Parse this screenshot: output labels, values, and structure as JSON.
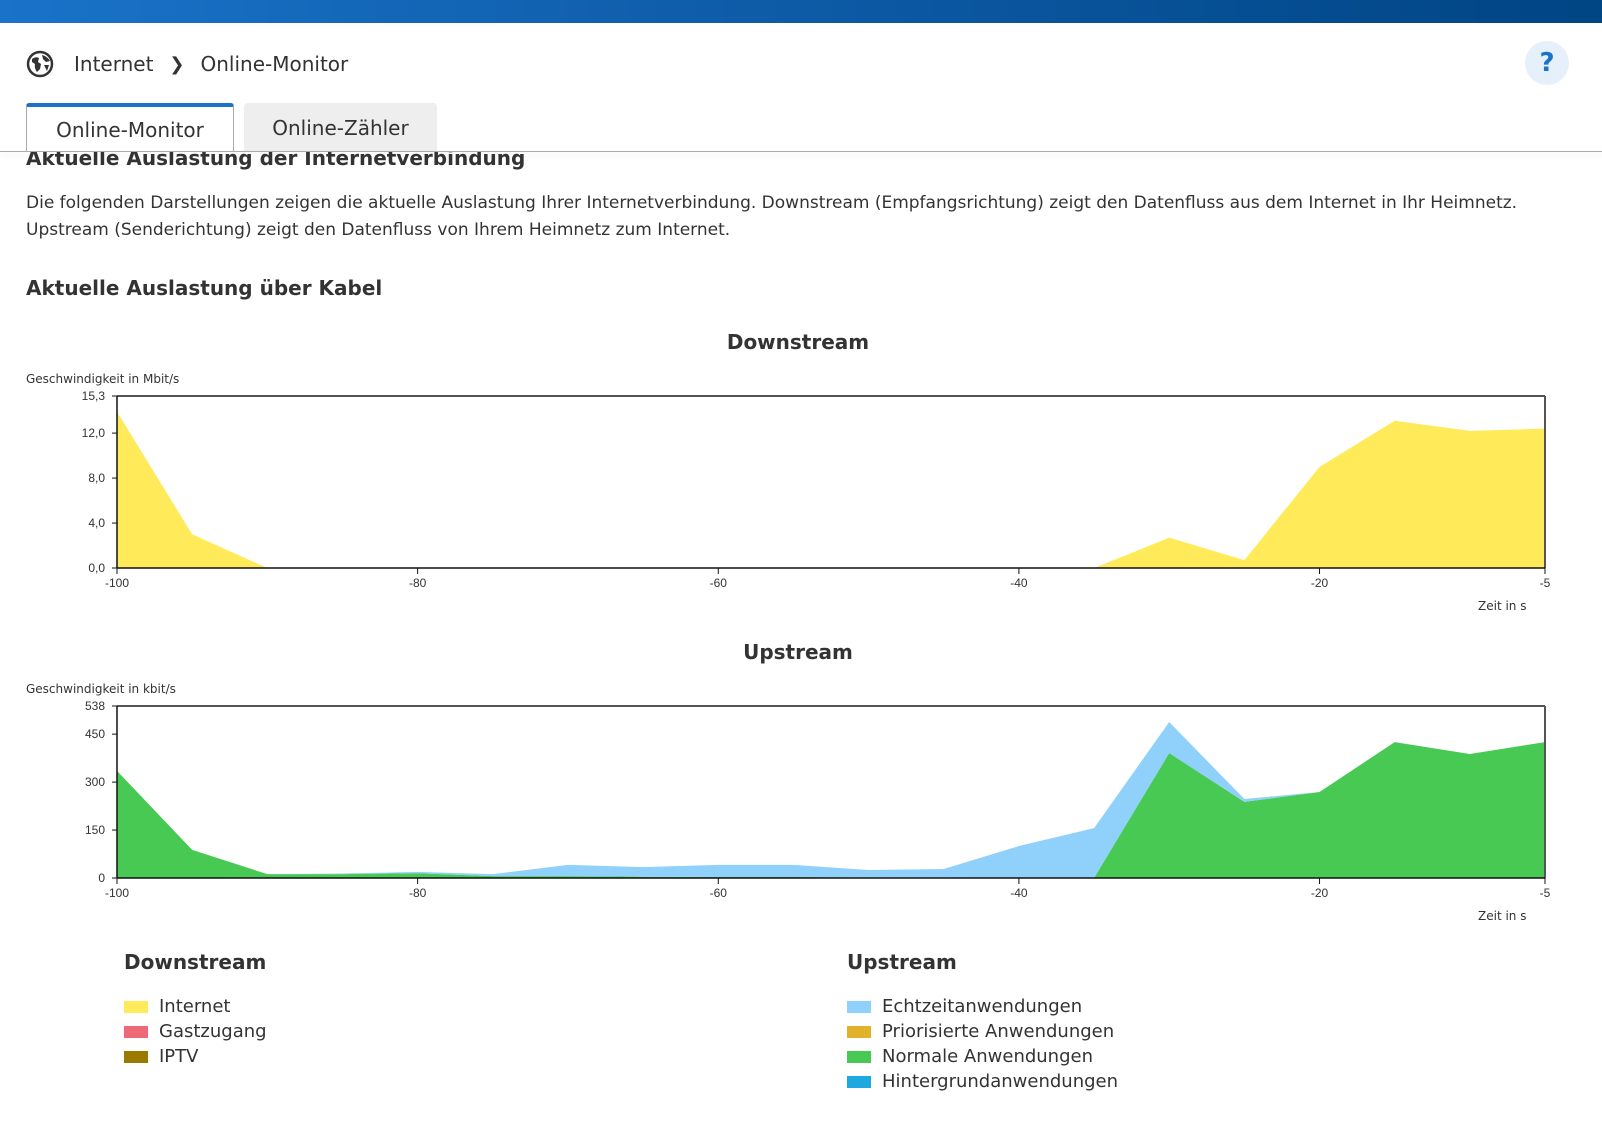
{
  "breadcrumb": {
    "icon": "globe-icon",
    "items": [
      "Internet",
      "Online-Monitor"
    ]
  },
  "help_label": "?",
  "tabs": [
    {
      "label": "Online-Monitor",
      "active": true
    },
    {
      "label": "Online-Zähler",
      "active": false
    }
  ],
  "heading": "Aktuelle Auslastung der Internetverbindung",
  "description": "Die folgenden Darstellungen zeigen die aktuelle Auslastung Ihrer Internetverbindung. Downstream (Empfangsrichtung) zeigt den Datenfluss aus dem Internet in Ihr Heimnetz. Upstream (Senderichtung) zeigt den Datenfluss von Ihrem Heimnetz zum Internet.",
  "subheading": "Aktuelle Auslastung über Kabel",
  "chart_data": [
    {
      "type": "area",
      "title": "Downstream",
      "ylabel": "Geschwindigkeit in Mbit/s",
      "xlabel": "Zeit in s",
      "xlim": [
        -100,
        -5
      ],
      "ylim": [
        0,
        15.3
      ],
      "xticks": [
        -100,
        -80,
        -60,
        -40,
        -20,
        -5
      ],
      "xtick_labels": [
        "-100",
        "-80",
        "-60",
        "-40",
        "-20",
        "-5"
      ],
      "yticks": [
        0,
        4,
        8,
        12,
        15.3
      ],
      "ytick_labels": [
        "0,0",
        "4,0",
        "8,0",
        "12,0",
        "15,3"
      ],
      "stacked": true,
      "x": [
        -100,
        -95,
        -90,
        -85,
        -80,
        -75,
        -70,
        -65,
        -60,
        -55,
        -50,
        -45,
        -40,
        -35,
        -30,
        -25,
        -20,
        -15,
        -10,
        -5
      ],
      "series": [
        {
          "name": "Internet",
          "color": "#ffeb5a",
          "values": [
            13.9,
            3.0,
            0,
            0,
            0,
            0,
            0,
            0,
            0,
            0,
            0,
            0,
            0,
            0,
            2.7,
            0.7,
            9.0,
            13.1,
            12.2,
            12.4
          ]
        }
      ]
    },
    {
      "type": "area",
      "title": "Upstream",
      "ylabel": "Geschwindigkeit in kbit/s",
      "xlabel": "Zeit in s",
      "xlim": [
        -100,
        -5
      ],
      "ylim": [
        0,
        538
      ],
      "xticks": [
        -100,
        -80,
        -60,
        -40,
        -20,
        -5
      ],
      "xtick_labels": [
        "-100",
        "-80",
        "-60",
        "-40",
        "-20",
        "-5"
      ],
      "yticks": [
        0,
        150,
        300,
        450,
        538
      ],
      "ytick_labels": [
        "0",
        "150",
        "300",
        "450",
        "538"
      ],
      "stacked": true,
      "x": [
        -100,
        -95,
        -90,
        -85,
        -80,
        -75,
        -70,
        -65,
        -60,
        -55,
        -50,
        -45,
        -40,
        -35,
        -30,
        -25,
        -20,
        -15,
        -10,
        -5
      ],
      "series": [
        {
          "name": "Normale Anwendungen",
          "color": "#47c954",
          "values": [
            335,
            88,
            12,
            12,
            15,
            6,
            6,
            4,
            3,
            3,
            2,
            2,
            1,
            0,
            391,
            238,
            269,
            425,
            388,
            425
          ]
        },
        {
          "name": "Echtzeitanwendungen",
          "color": "#8fd1fb",
          "values": [
            0,
            0,
            0,
            2,
            4,
            6,
            35,
            30,
            38,
            38,
            23,
            26,
            99,
            156,
            97,
            9,
            0,
            0,
            0,
            0
          ]
        }
      ]
    }
  ],
  "legend": {
    "downstream": {
      "title": "Downstream",
      "items": [
        {
          "label": "Internet",
          "color": "#ffeb5a"
        },
        {
          "label": "Gastzugang",
          "color": "#ec6b77"
        },
        {
          "label": "IPTV",
          "color": "#9c7a00"
        }
      ]
    },
    "upstream": {
      "title": "Upstream",
      "items": [
        {
          "label": "Echtzeitanwendungen",
          "color": "#8fd1fb"
        },
        {
          "label": "Priorisierte Anwendungen",
          "color": "#e3b22d"
        },
        {
          "label": "Normale Anwendungen",
          "color": "#47c954"
        },
        {
          "label": "Hintergrundanwendungen",
          "color": "#1ea8e0"
        }
      ]
    }
  }
}
